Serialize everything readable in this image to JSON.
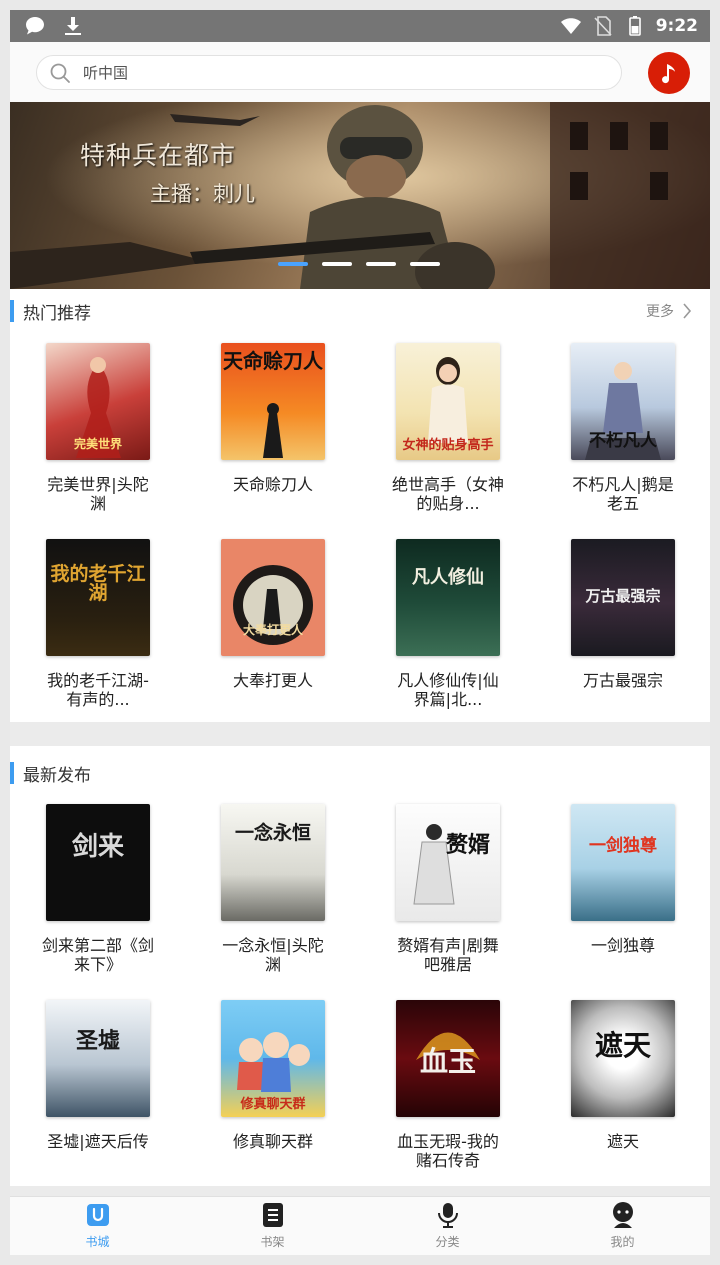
{
  "status_bar": {
    "time": "9:22",
    "left_icons": [
      "chat-bubble-icon",
      "download-icon"
    ],
    "right_icons": [
      "wifi-icon",
      "no-sim-icon",
      "battery-icon"
    ]
  },
  "search": {
    "placeholder": "听中国",
    "value": ""
  },
  "music_button": {
    "icon": "music-note-icon",
    "color": "#d81e06"
  },
  "banner": {
    "title": "特种兵在都市",
    "host": "主播：刺儿",
    "dots_total": 4,
    "active_dot": 0
  },
  "hot_section": {
    "title": "热门推荐",
    "more_label": "更多",
    "books": [
      {
        "title": "完美世界|头陀渊",
        "cover_text": "完美世界"
      },
      {
        "title": "天命赊刀人",
        "cover_text": "天命赊刀人"
      },
      {
        "title": "绝世高手（女神的贴身...",
        "cover_text": "女神的贴身高手"
      },
      {
        "title": "不朽凡人|鹅是老五",
        "cover_text": "不朽凡人"
      },
      {
        "title": "我的老千江湖-有声的...",
        "cover_text": "我的老千江湖"
      },
      {
        "title": "大奉打更人",
        "cover_text": "大奉打更人"
      },
      {
        "title": "凡人修仙传|仙界篇|北...",
        "cover_text": "凡人修仙"
      },
      {
        "title": "万古最强宗",
        "cover_text": "万古最强宗"
      }
    ]
  },
  "new_section": {
    "title": "最新发布",
    "books": [
      {
        "title": "剑来第二部《剑来下》",
        "cover_text": "剑来"
      },
      {
        "title": "一念永恒|头陀渊",
        "cover_text": "一念永恒"
      },
      {
        "title": "赘婿有声|剧舞吧雅居",
        "cover_text": "赘婿"
      },
      {
        "title": "一剑独尊",
        "cover_text": "一剑独尊"
      },
      {
        "title": "圣墟|遮天后传",
        "cover_text": "圣墟"
      },
      {
        "title": "修真聊天群",
        "cover_text": "修真聊天群"
      },
      {
        "title": "血玉无瑕-我的赌石传奇",
        "cover_text": "血玉"
      },
      {
        "title": "遮天",
        "cover_text": "遮天"
      }
    ]
  },
  "bottom_nav": {
    "items": [
      {
        "label": "书城",
        "icon": "bookstore-icon",
        "active": true
      },
      {
        "label": "书架",
        "icon": "bookshelf-icon",
        "active": false
      },
      {
        "label": "分类",
        "icon": "microphone-icon",
        "active": false
      },
      {
        "label": "我的",
        "icon": "profile-icon",
        "active": false
      }
    ]
  }
}
